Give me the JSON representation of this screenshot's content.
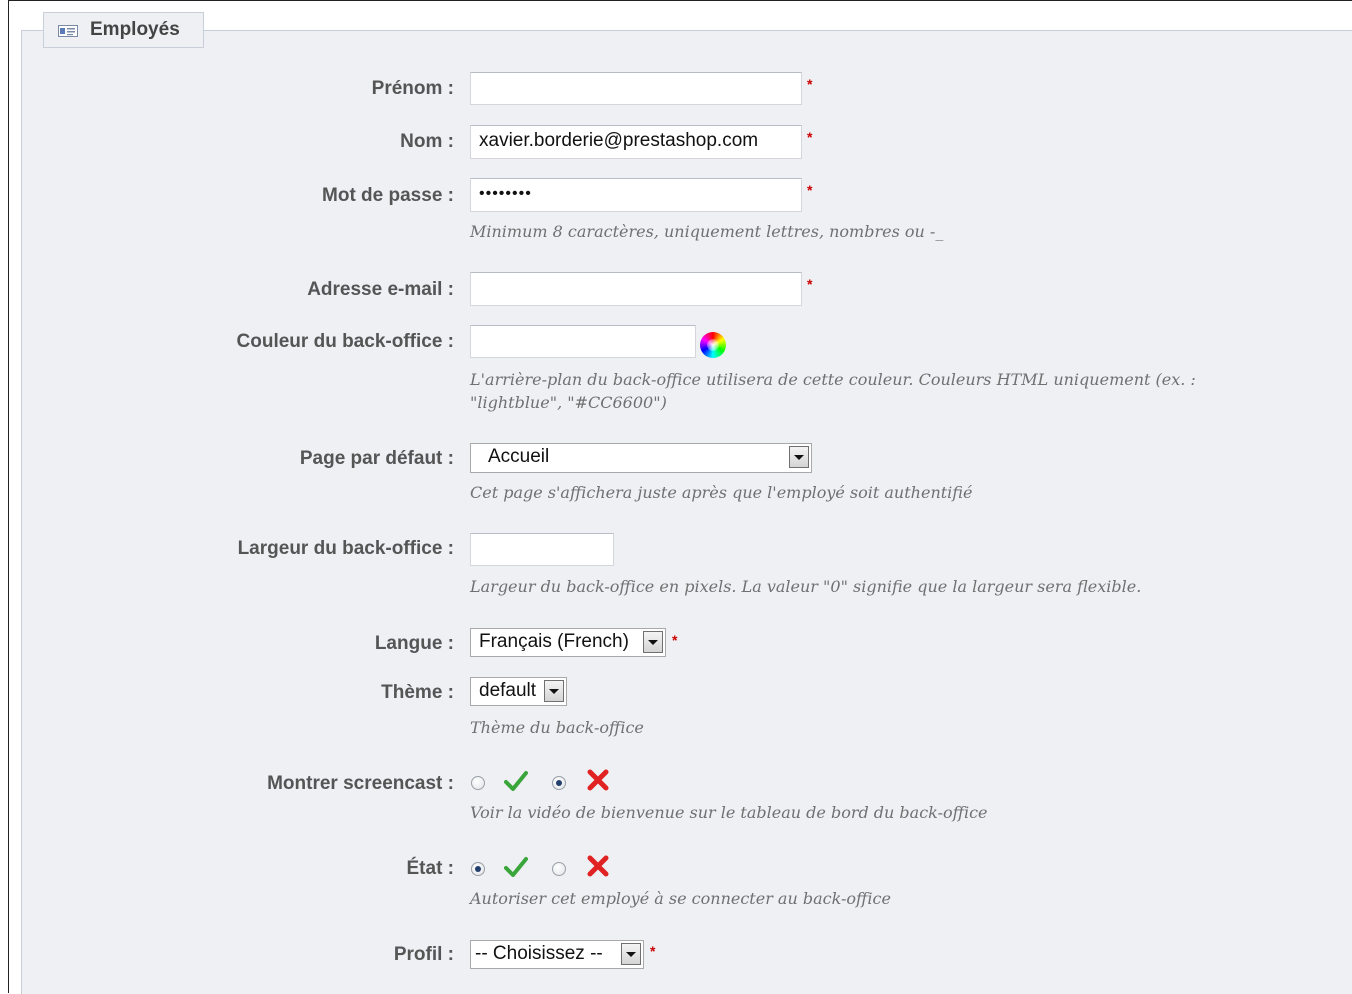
{
  "section": {
    "title": "Employés",
    "icon": "employee-card-icon"
  },
  "fields": {
    "prenom": {
      "label": "Prénom :",
      "value": ""
    },
    "nom": {
      "label": "Nom :",
      "value": "xavier.borderie@prestashop.com"
    },
    "password": {
      "label": "Mot de passe :",
      "value": "••••••••",
      "help": "Minimum 8 caractères, uniquement lettres, nombres ou -_"
    },
    "email": {
      "label": "Adresse e-mail :",
      "value": ""
    },
    "bo_color": {
      "label": "Couleur du back-office :",
      "value": "",
      "help_line1": "L'arrière-plan du back-office utilisera de cette couleur. Couleurs HTML uniquement (ex. :",
      "help_line2": "\"lightblue\", \"#CC6600\")",
      "icon": "color-picker-icon"
    },
    "default_page": {
      "label": "Page par défaut :",
      "selected": "Accueil",
      "help": "Cet page s'affichera juste après que l'employé soit authentifié"
    },
    "bo_width": {
      "label": "Largeur du back-office :",
      "value": "",
      "help": "Largeur du back-office en pixels. La valeur \"0\" signifie que la largeur sera flexible."
    },
    "language": {
      "label": "Langue :",
      "selected": "Français (French)"
    },
    "theme": {
      "label": "Thème :",
      "selected": "default",
      "help": "Thème du back-office"
    },
    "screencast": {
      "label": "Montrer screencast :",
      "selected": "no",
      "help": "Voir la vidéo de bienvenue sur le tableau de bord du back-office"
    },
    "state": {
      "label": "État :",
      "selected": "yes",
      "help": "Autoriser cet employé à se connecter au back-office"
    },
    "profile": {
      "label": "Profil :",
      "selected": "-- Choisissez --"
    }
  },
  "required_marker": "*",
  "colors": {
    "required": "#cc0000",
    "yes_icon": "#3aa53a",
    "no_icon": "#e02222",
    "panel_bg": "#eef0f4"
  }
}
